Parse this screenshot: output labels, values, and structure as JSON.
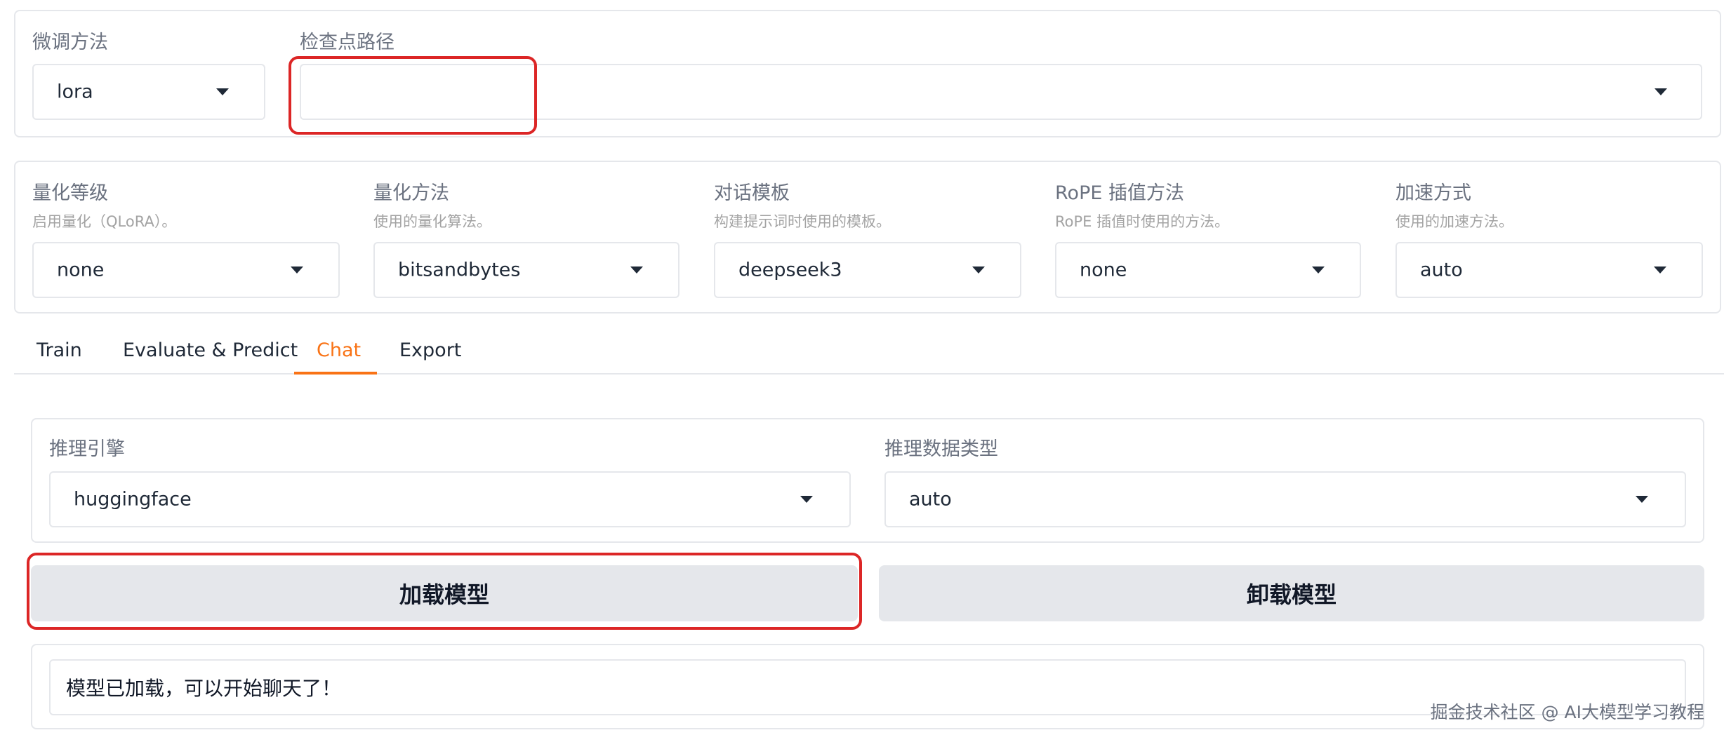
{
  "top_panel": {
    "finetune": {
      "label": "微调方法",
      "value": "lora"
    },
    "checkpoint": {
      "label": "检查点路径",
      "value": ""
    }
  },
  "settings_panel": {
    "quant_bit": {
      "label": "量化等级",
      "hint": "启用量化（QLoRA）。",
      "value": "none"
    },
    "quant_method": {
      "label": "量化方法",
      "hint": "使用的量化算法。",
      "value": "bitsandbytes"
    },
    "template": {
      "label": "对话模板",
      "hint": "构建提示词时使用的模板。",
      "value": "deepseek3"
    },
    "rope": {
      "label": "RoPE 插值方法",
      "hint": "RoPE 插值时使用的方法。",
      "value": "none"
    },
    "booster": {
      "label": "加速方式",
      "hint": "使用的加速方法。",
      "value": "auto"
    }
  },
  "tabs": [
    {
      "label": "Train"
    },
    {
      "label": "Evaluate & Predict"
    },
    {
      "label": "Chat"
    },
    {
      "label": "Export"
    }
  ],
  "active_tab": "Chat",
  "chat": {
    "backend": {
      "label": "推理引擎",
      "value": "huggingface"
    },
    "dtype": {
      "label": "推理数据类型",
      "value": "auto"
    },
    "load_button": "加载模型",
    "unload_button": "卸载模型",
    "status": "模型已加载，可以开始聊天了！"
  },
  "watermark": "掘金技术社区 @ AI大模型学习教程",
  "colors": {
    "accent": "#f97316",
    "highlight": "#dc2626",
    "button_bg": "#e5e7eb",
    "border": "#e5e7eb"
  }
}
